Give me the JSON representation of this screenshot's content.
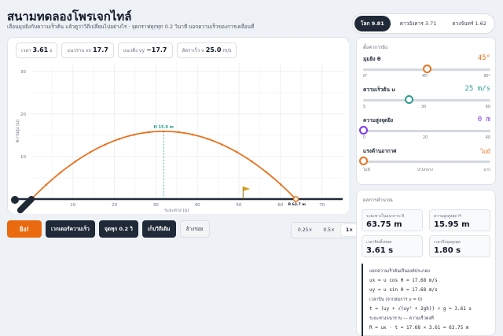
{
  "header": {
    "title": "สนามทดลองโพรเจกไทล์",
    "subtitle": "เลื่อนมุมยิงกับความเร็วต้น แล้วดูว่าวิถีเปลี่ยนไปอย่างไร · จุดกราฟทุกทุก 0.2 วินาที บอกความเร็วของการเคลื่อนที่"
  },
  "gravity_tabs": [
    {
      "label": "โลก 9.81",
      "active": true
    },
    {
      "label": "ดาวอังคาร 3.71",
      "active": false
    },
    {
      "label": "ดวงจันทร์ 1.62",
      "active": false
    }
  ],
  "readout": {
    "time": {
      "label": "เวลา",
      "value": "3.61",
      "unit": "s"
    },
    "vx": {
      "label": "แนวราบ vx",
      "value": "17.7",
      "unit": ""
    },
    "vy": {
      "label": "แนวดิ่ง vy",
      "value": "−17.7",
      "unit": ""
    },
    "speed": {
      "label": "อัตราเร็ว v",
      "value": "25.0",
      "unit": "m/s"
    }
  },
  "chart_data": {
    "type": "line",
    "xlabel": "ระยะทาง (ม)",
    "ylabel": "ความสูง (ม)",
    "xlim": [
      0,
      75
    ],
    "ylim": [
      0,
      32
    ],
    "x_ticks": [
      "10",
      "20",
      "30",
      "40",
      "50",
      "60",
      "70"
    ],
    "y_ticks": [
      "10",
      "20",
      "30"
    ],
    "launch_angle_deg": 45,
    "launch_speed": 25,
    "gravity": 9.81,
    "marker_step_s": 0.2,
    "apex": {
      "x": 31.86,
      "y": 15.95,
      "label": "H 15.9 m"
    },
    "landing": {
      "x": 63.75,
      "y": 0,
      "label": "R 63.7 m"
    },
    "target_flag_x": 51,
    "colors": {
      "path": "#e8731f",
      "cannon": "#1f2937",
      "apex_guide": "#2a9d8f",
      "flag": "#d4a017"
    }
  },
  "controls": {
    "fire": "ยิง!",
    "vector_toggle": "เวกเตอร์ความเร็ว",
    "dots_toggle": "จุดทุก 0.2 วิ",
    "keep_toggle": "เก็บวิถีเดิม",
    "reset": "ล้างรอย",
    "speeds": [
      {
        "label": "0.25×",
        "active": false
      },
      {
        "label": "0.5×",
        "active": false
      },
      {
        "label": "1×",
        "active": true
      }
    ]
  },
  "settings": {
    "section_title": "ตั้งค่าการยิง",
    "angle": {
      "label": "มุมยิง θ",
      "value": "45°",
      "fraction": 0.5,
      "color": "#e8731f",
      "ticks": [
        "0°",
        "45°",
        "90°"
      ]
    },
    "speed": {
      "label": "ความเร็วต้น u",
      "value": "25 m/s",
      "fraction": 0.364,
      "color": "#2a9d8f",
      "ticks": [
        "5",
        "30",
        "60"
      ]
    },
    "height": {
      "label": "ความสูงจุดยิง",
      "value": "0 m",
      "fraction": 0.0,
      "color": "#7c3aed",
      "ticks": [
        "0",
        "20",
        "40"
      ]
    },
    "drag": {
      "label": "แรงต้านอากาศ",
      "value": "ไม่มี",
      "fraction": 0.0,
      "color": "#e8731f",
      "ticks": [
        "ไม่มี",
        "ปานกลาง",
        "มาก"
      ]
    }
  },
  "results": {
    "section_title": "ผลการคำนวณ",
    "range": {
      "label": "ระยะทางในแนวราบ R",
      "value": "63.75 m"
    },
    "peak": {
      "label": "ความสูงสูงสุด H",
      "value": "15.95 m"
    },
    "flight_time": {
      "label": "เวลาบินทั้งหมด",
      "value": "3.61 s"
    },
    "time_to_peak": {
      "label": "เวลาถึงจุดสูงสุด",
      "value": "1.80 s"
    },
    "formula_lines": [
      "แยกความเร็วต้นเป็นองค์ประกอบ",
      "ux = u cos θ = 17.68 m/s",
      "uy = u sin θ = 17.68 m/s",
      "เวลาบิน (จากสมการ y = 0)",
      "t = (uy + √(uy² + 2gh)) ÷ g = 3.61 s",
      "ระยะทางแนวราบ — ความเร็วคงที่",
      "R = ux · t = 17.68 × 3.61 = 63.75 m"
    ]
  }
}
